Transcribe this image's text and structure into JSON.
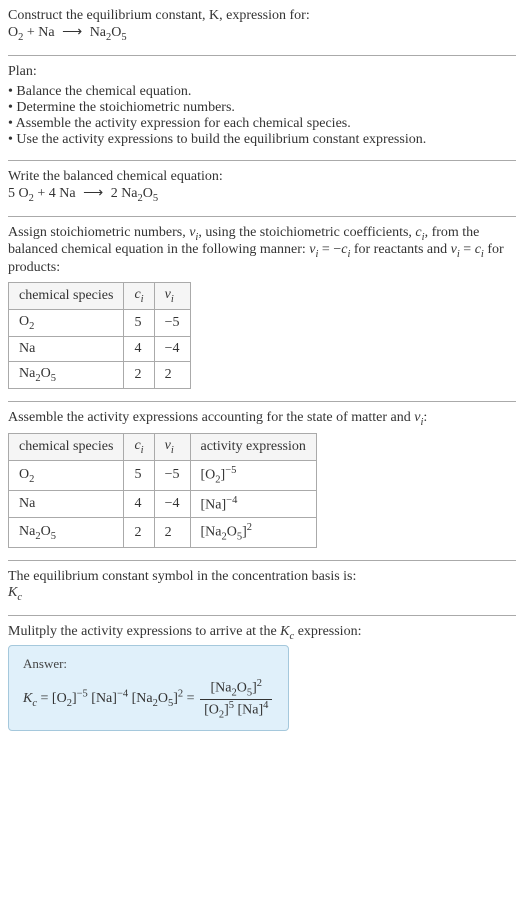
{
  "header": {
    "prompt": "Construct the equilibrium constant, K, expression for:",
    "equation_lhs1": "O",
    "equation_lhs1_sub": "2",
    "equation_plus": " + Na",
    "equation_arrow": "⟶",
    "equation_rhs": "Na",
    "equation_rhs_sub1": "2",
    "equation_rhs_mid": "O",
    "equation_rhs_sub2": "5"
  },
  "plan": {
    "title": "Plan:",
    "items": [
      "Balance the chemical equation.",
      "Determine the stoichiometric numbers.",
      "Assemble the activity expression for each chemical species.",
      "Use the activity expressions to build the equilibrium constant expression."
    ]
  },
  "balanced": {
    "intro": "Write the balanced chemical equation:",
    "c1": "5 O",
    "c1sub": "2",
    "plus1": " + 4 Na ",
    "arrow": "⟶",
    "c2": " 2 Na",
    "c2sub1": "2",
    "c2mid": "O",
    "c2sub2": "5"
  },
  "stoich": {
    "intro_part1": "Assign stoichiometric numbers, ",
    "intro_nu": "ν",
    "intro_isub": "i",
    "intro_part2": ", using the stoichiometric coefficients, ",
    "intro_c": "c",
    "intro_part3": ", from the balanced chemical equation in the following manner: ",
    "intro_eq1a": "ν",
    "intro_eq1b": " = −",
    "intro_eq1c": "c",
    "intro_part4": " for reactants and ",
    "intro_eq2a": "ν",
    "intro_eq2b": " = ",
    "intro_eq2c": "c",
    "intro_part5": " for products:",
    "table": {
      "headers": [
        "chemical species",
        "c_i",
        "ν_i"
      ],
      "h1": "chemical species",
      "h2_base": "c",
      "h2_sub": "i",
      "h3_base": "ν",
      "h3_sub": "i",
      "rows": [
        {
          "species_base": "O",
          "species_sub": "2",
          "ci": "5",
          "vi": "−5"
        },
        {
          "species_base": "Na",
          "species_sub": "",
          "ci": "4",
          "vi": "−4"
        },
        {
          "species_base": "Na",
          "species_sub": "2",
          "species_mid": "O",
          "species_sub2": "5",
          "ci": "2",
          "vi": "2"
        }
      ]
    }
  },
  "activity": {
    "intro_part1": "Assemble the activity expressions accounting for the state of matter and ",
    "intro_nu": "ν",
    "intro_isub": "i",
    "intro_part2": ":",
    "table": {
      "h1": "chemical species",
      "h2_base": "c",
      "h2_sub": "i",
      "h3_base": "ν",
      "h3_sub": "i",
      "h4": "activity expression",
      "rows": [
        {
          "species_base": "O",
          "species_sub": "2",
          "ci": "5",
          "vi": "−5",
          "act_open": "[O",
          "act_sub": "2",
          "act_close": "]",
          "act_exp": "−5"
        },
        {
          "species_base": "Na",
          "species_sub": "",
          "ci": "4",
          "vi": "−4",
          "act_open": "[Na]",
          "act_sub": "",
          "act_close": "",
          "act_exp": "−4"
        },
        {
          "species_base": "Na",
          "species_sub": "2",
          "species_mid": "O",
          "species_sub2": "5",
          "ci": "2",
          "vi": "2",
          "act_open": "[Na",
          "act_sub": "2",
          "act_mid": "O",
          "act_sub2": "5",
          "act_close": "]",
          "act_exp": "2"
        }
      ]
    }
  },
  "symbol": {
    "intro": "The equilibrium constant symbol in the concentration basis is:",
    "K": "K",
    "Ksub": "c"
  },
  "multiply": {
    "intro_part1": "Mulitply the activity expressions to arrive at the ",
    "K": "K",
    "Ksub": "c",
    "intro_part2": " expression:"
  },
  "answer": {
    "label": "Answer:",
    "K": "K",
    "Ksub": "c",
    "eq": " = [O",
    "o2sub": "2",
    "close1": "]",
    "exp1": "−5",
    "na": " [Na]",
    "exp2": "−4",
    "na2o5": " [Na",
    "n2sub": "2",
    "omid": "O",
    "n5sub": "5",
    "close2": "]",
    "exp3": "2",
    "eq2": " = ",
    "frac_num_a": "[Na",
    "frac_num_sub1": "2",
    "frac_num_mid": "O",
    "frac_num_sub2": "5",
    "frac_num_close": "]",
    "frac_num_exp": "2",
    "frac_den_a": "[O",
    "frac_den_sub1": "2",
    "frac_den_close1": "]",
    "frac_den_exp1": "5",
    "frac_den_b": " [Na]",
    "frac_den_exp2": "4"
  }
}
